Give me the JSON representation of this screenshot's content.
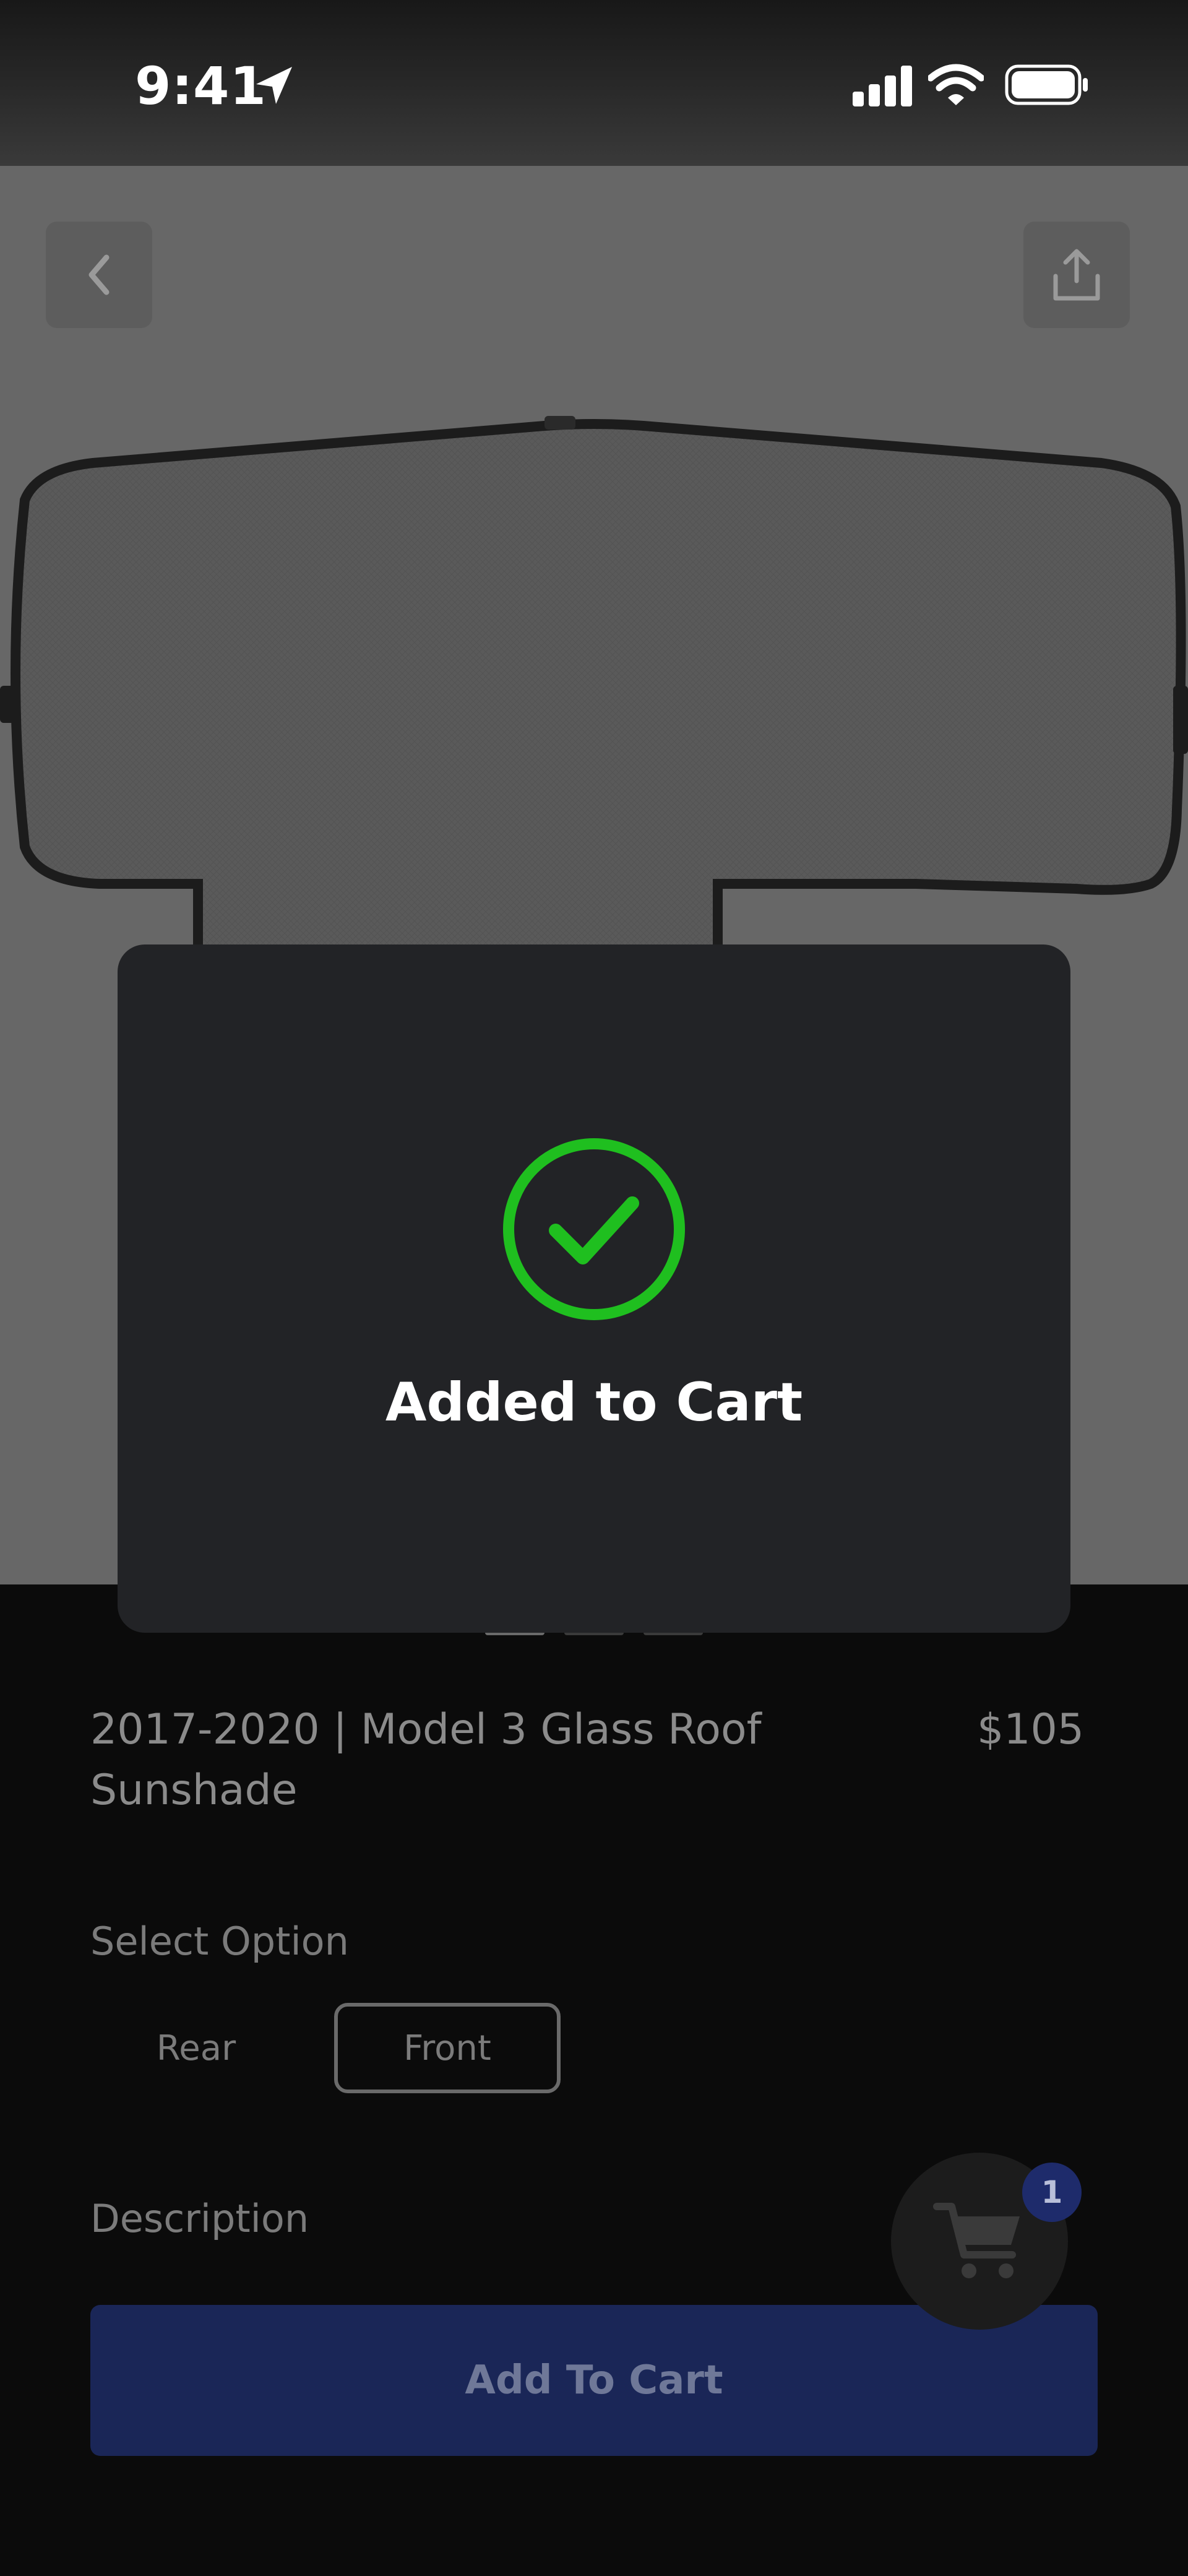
{
  "status_bar": {
    "time": "9:41",
    "icons": [
      "location-arrow-icon",
      "cellular-signal-icon",
      "wifi-icon",
      "battery-icon"
    ]
  },
  "header": {
    "back_icon": "chevron-left-icon",
    "share_icon": "share-icon"
  },
  "gallery": {
    "image": "glass-roof-sunshade",
    "slides": 3,
    "active_slide": 1
  },
  "product": {
    "title": "2017-2020 | Model 3 Glass Roof Sunshade",
    "price": "$105"
  },
  "options": {
    "label": "Select Option",
    "items": [
      {
        "label": "Rear",
        "selected": false
      },
      {
        "label": "Front",
        "selected": true
      }
    ]
  },
  "description": {
    "label": "Description"
  },
  "cart": {
    "icon": "cart-icon",
    "count": "1"
  },
  "actions": {
    "add_to_cart": "Add To Cart"
  },
  "toast": {
    "icon": "check-circle-icon",
    "message": "Added to Cart"
  },
  "colors": {
    "accent_blue": "#1a2657",
    "success_green": "#1fbf1f",
    "toast_bg": "#222326",
    "sheet_bg": "#0b0b0b"
  }
}
